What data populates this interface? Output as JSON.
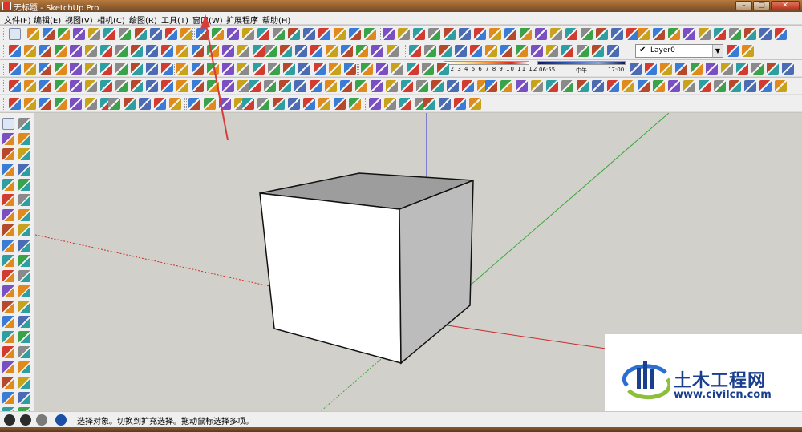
{
  "window": {
    "title": "无标题 - SketchUp Pro"
  },
  "menus": [
    "文件(F)",
    "编辑(E)",
    "视图(V)",
    "相机(C)",
    "绘图(R)",
    "工具(T)",
    "窗口(W)",
    "扩展程序",
    "帮助(H)"
  ],
  "shadow": {
    "time_months": "1 2 3 4 5 6 7 8 9 10 11 12",
    "time_start": "06:55",
    "time_mid": "中午",
    "time_end": "17:00"
  },
  "layer": {
    "selected": "Layer0"
  },
  "status": {
    "message": "选择对象。切换到扩充选择。拖动鼠标选择多项。"
  },
  "watermark": {
    "name": "土木工程网",
    "url": "www.civilcn.com"
  },
  "colors": {
    "x_axis": "#cc2a2a",
    "y_axis": "#39a83a",
    "z_axis": "#2b2bd0",
    "viewport_bg": "#d1d0ca",
    "cube_top": "#9d9d9d",
    "cube_front": "#ffffff",
    "cube_right": "#bcbcbc",
    "annotation_arrow": "#d93a3a",
    "brand": "#1b3f8f"
  },
  "icons": {
    "select": "select-arrow-icon",
    "eraser": "eraser-icon",
    "pencil": "pencil-icon",
    "shape": "shape-icon",
    "paint": "paint-bucket-icon",
    "push_pull": "push-pull-icon",
    "move": "move-icon",
    "rotate": "rotate-icon",
    "scale": "scale-icon",
    "orbit": "orbit-icon",
    "pan": "pan-icon",
    "zoom": "zoom-icon",
    "zoom_extents": "zoom-extents-icon",
    "tape": "tape-measure-icon",
    "text": "text-icon",
    "axes": "axes-icon",
    "walk": "walk-icon",
    "help": "help-icon",
    "info": "info-icon",
    "user": "user-icon",
    "geo": "geo-location-icon"
  }
}
